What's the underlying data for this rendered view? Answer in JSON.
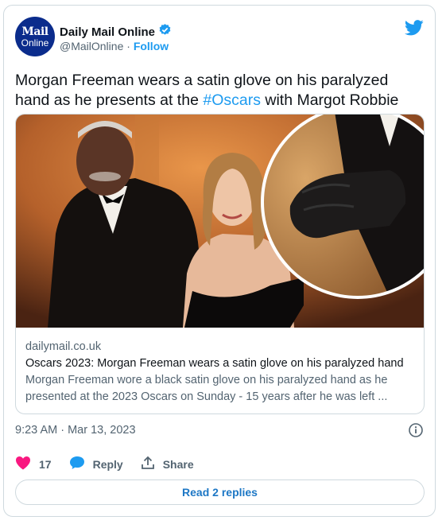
{
  "account": {
    "avatar_line1": "Mail",
    "avatar_line2": "Online",
    "name": "Daily Mail Online",
    "handle": "@MailOnline",
    "separator": "·",
    "follow_label": "Follow"
  },
  "tweet": {
    "text_before": "Morgan Freeman wears a satin glove on his paralyzed hand as he presents at the ",
    "hashtag": "#Oscars",
    "text_after": " with Margot Robbie"
  },
  "link_card": {
    "domain": "dailymail.co.uk",
    "title": "Oscars 2023: Morgan Freeman wears a satin glove on his paralyzed hand",
    "description": "Morgan Freeman wore a black satin glove on his paralyzed hand as he presented at the 2023 Oscars on Sunday - 15 years after he was left ..."
  },
  "timestamp": "9:23 AM · Mar 13, 2023",
  "actions": {
    "like_count": "17",
    "reply_label": "Reply",
    "share_label": "Share"
  },
  "read_replies_label": "Read 2 replies",
  "colors": {
    "accent": "#1d9bf0",
    "like": "#f91880",
    "avatar_bg": "#0b2c8c"
  },
  "icons": [
    "verified-badge-icon",
    "twitter-bird-icon",
    "info-icon",
    "heart-icon",
    "reply-bubble-icon",
    "share-icon"
  ]
}
